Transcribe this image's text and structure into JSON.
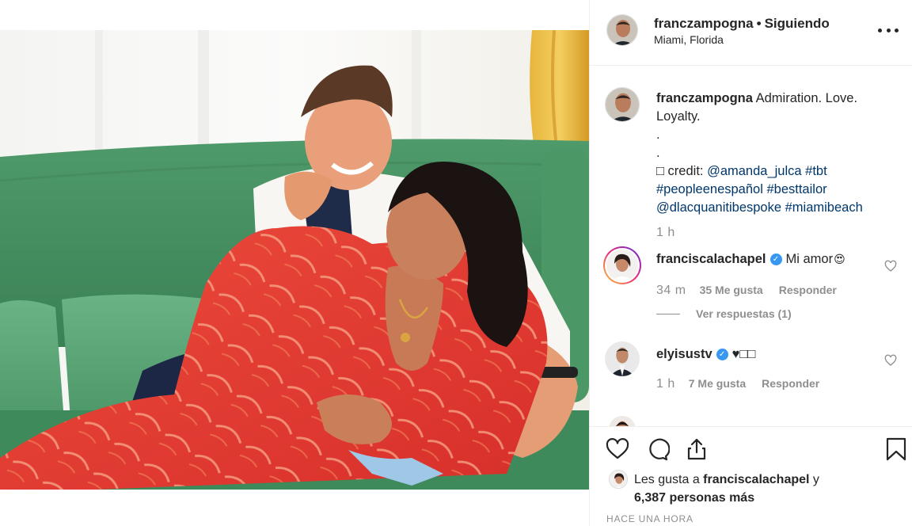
{
  "post": {
    "username": "franczampogna",
    "separator": "•",
    "follow_status": "Siguiendo",
    "location": "Miami, Florida",
    "more_icon": "more-horizontal-icon"
  },
  "caption": {
    "username": "franczampogna",
    "text_1": "Admiration. Love.",
    "text_2": "Loyalty.",
    "dot_1": ".",
    "dot_2": ".",
    "credit_prefix": "□ credit: ",
    "mention_1": "@amanda_julca",
    "hashtag_1": "#tbt",
    "hashtag_2": "#peopleenespañol",
    "hashtag_3": "#besttailor",
    "mention_2": "@dlacquanitibespoke",
    "hashtag_4": "#miamibeach",
    "time": "1 h"
  },
  "comments": [
    {
      "username": "franciscalachapel",
      "verified": true,
      "text": "Mi amor",
      "emoji": "😍",
      "time": "34 m",
      "likes": "35 Me gusta",
      "reply": "Responder",
      "view_replies": "Ver respuestas (1)"
    },
    {
      "username": "elyisustv",
      "verified": true,
      "text": "♥□□",
      "time": "1 h",
      "likes": "7 Me gusta",
      "reply": "Responder"
    }
  ],
  "actions": {
    "like_icon": "heart-icon",
    "comment_icon": "comment-icon",
    "share_icon": "share-icon",
    "save_icon": "bookmark-icon"
  },
  "likes_summary": {
    "prefix": "Les gusta a ",
    "user": "franciscalachapel",
    "conj": " y",
    "others": "6,387 personas más"
  },
  "timestamp": "HACE UNA HORA",
  "colors": {
    "link": "#00376b",
    "secondary_text": "#8e8e8e",
    "verified": "#3897f0",
    "border": "#efefef"
  }
}
